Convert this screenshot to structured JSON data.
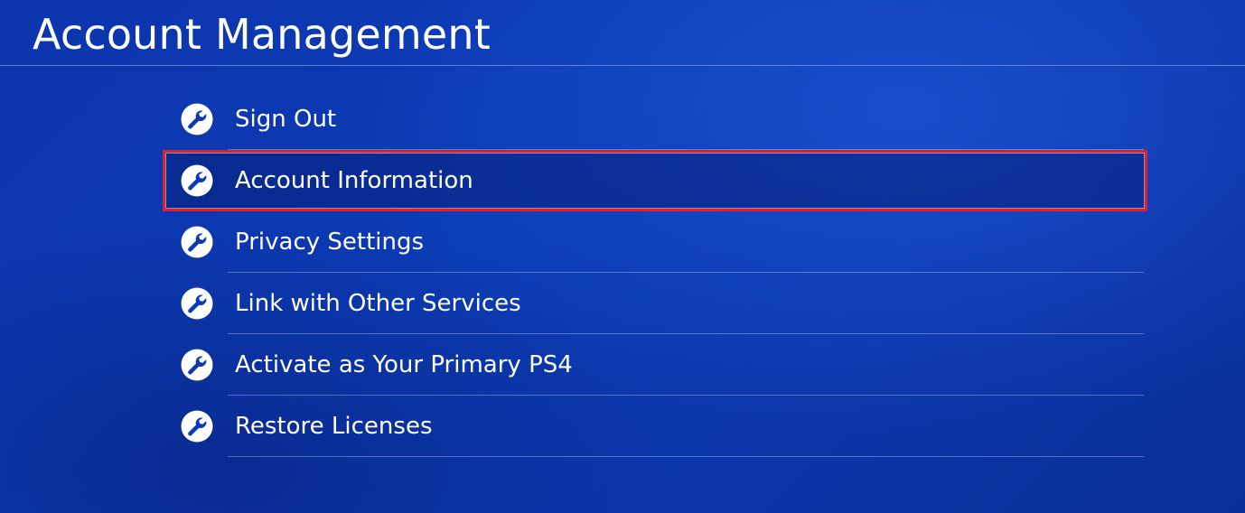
{
  "header": {
    "title": "Account Management"
  },
  "menu": {
    "items": [
      {
        "label": "Sign Out",
        "icon": "wrench-icon",
        "selected": false
      },
      {
        "label": "Account Information",
        "icon": "wrench-icon",
        "selected": true
      },
      {
        "label": "Privacy Settings",
        "icon": "wrench-icon",
        "selected": false
      },
      {
        "label": "Link with Other Services",
        "icon": "wrench-icon",
        "selected": false
      },
      {
        "label": "Activate as Your Primary PS4",
        "icon": "wrench-icon",
        "selected": false
      },
      {
        "label": "Restore Licenses",
        "icon": "wrench-icon",
        "selected": false
      }
    ]
  },
  "colors": {
    "background": "#0b3bb4",
    "text": "#ffffff",
    "selection_border": "#e0202c"
  }
}
